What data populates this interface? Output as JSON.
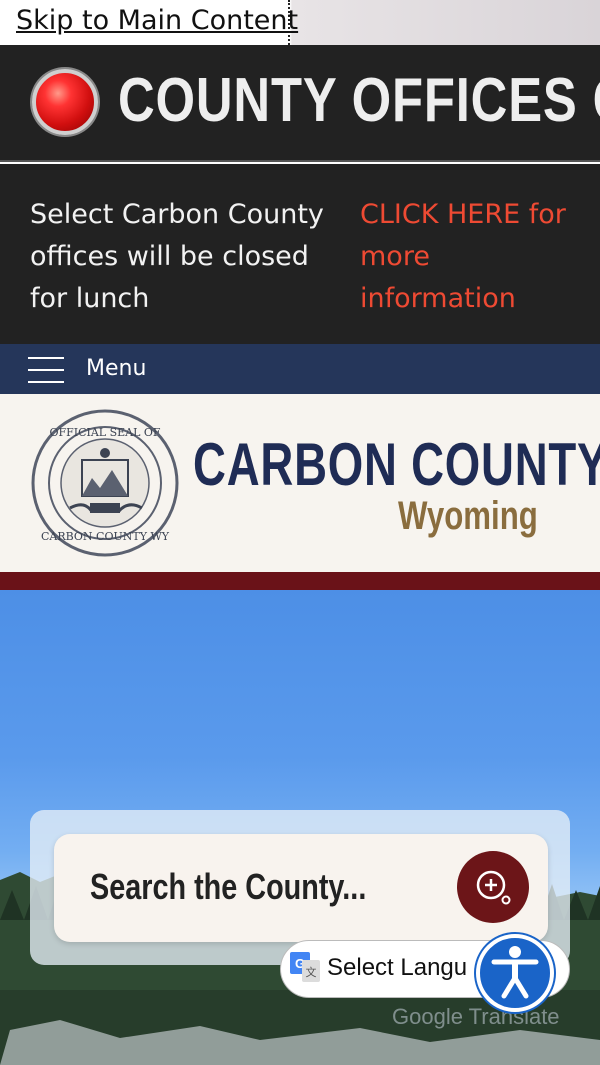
{
  "skip_link": "Skip to Main Content",
  "alert": {
    "title": "COUNTY OFFICES C",
    "notice_text": "Select Carbon County offices will be closed for lunch",
    "notice_link": "CLICK HERE for more information"
  },
  "menu": {
    "label": "Menu"
  },
  "brand": {
    "name": "CARBON COUNTY",
    "state": "Wyoming",
    "seal_text": "OFFICIAL SEAL OF CARBON COUNTY WY"
  },
  "search": {
    "placeholder": "Search the County..."
  },
  "translate": {
    "label": "Select Langu",
    "powered": "Google Translate"
  },
  "colors": {
    "alert_bg": "#222222",
    "alert_link": "#ee4a33",
    "menu_bg": "#25365a",
    "brand_navy": "#1f2c55",
    "brand_gold": "#8a6d3e",
    "maroon": "#6a1218",
    "accessibility_blue": "#1a64c8"
  },
  "icons": {
    "alert": "red-alert-dot-icon",
    "menu": "hamburger-icon",
    "search": "search-plus-icon",
    "translate": "google-translate-icon",
    "accessibility": "accessibility-person-icon"
  }
}
